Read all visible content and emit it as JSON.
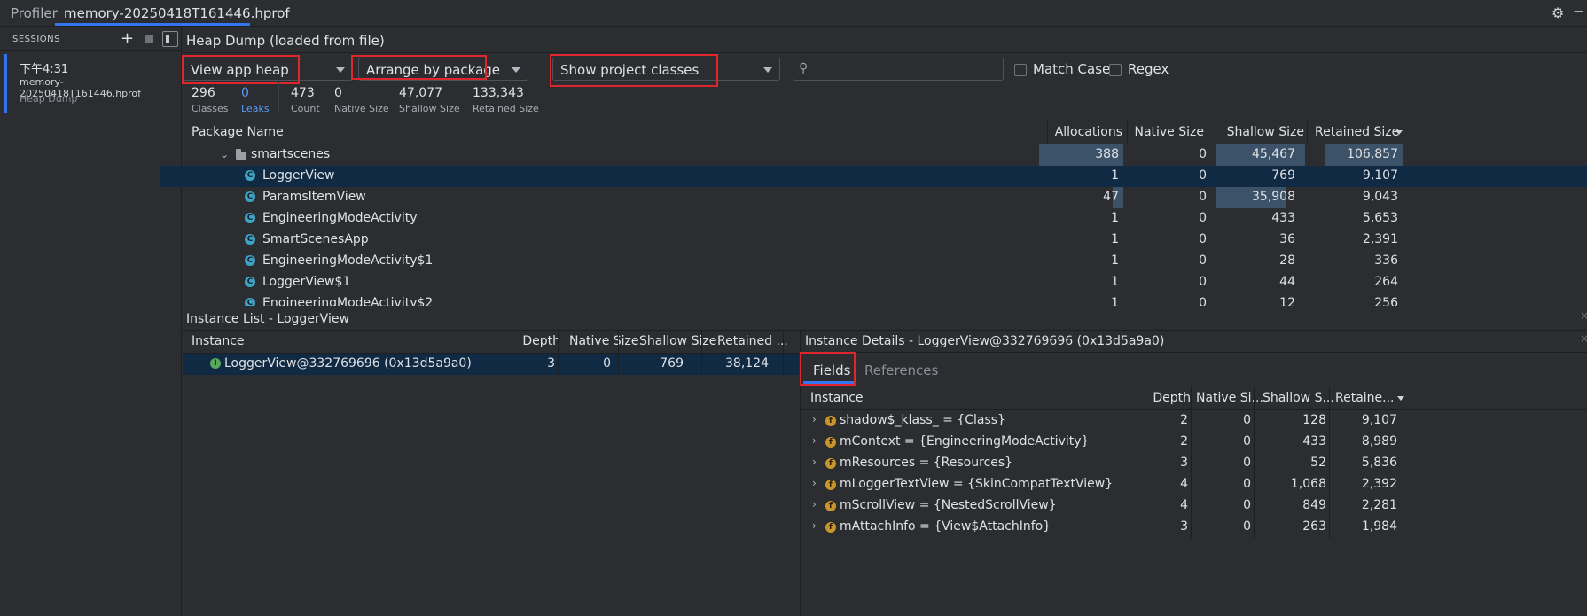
{
  "topbar": {
    "tool_title": "Profiler",
    "file_tab": "memory-20250418T161446.hprof",
    "settings_icon": "gear-icon",
    "minimize_icon": "minus-icon"
  },
  "sessions": {
    "header": "SESSIONS",
    "add_label": "+",
    "item": {
      "time": "下午4:31",
      "file": "memory-20250418T161446.hprof",
      "kind": "Heap Dump"
    }
  },
  "main": {
    "title": "Heap Dump (loaded from file)",
    "heap_select": "View app heap",
    "arrange_select": "Arrange by package",
    "filter_select": "Show project classes",
    "search_placeholder": "",
    "match_case": "Match Case",
    "regex": "Regex"
  },
  "stats": [
    {
      "value": "296",
      "label": "Classes"
    },
    {
      "value": "0",
      "label": "Leaks"
    },
    {
      "value": "473",
      "label": "Count"
    },
    {
      "value": "0",
      "label": "Native Size"
    },
    {
      "value": "47,077",
      "label": "Shallow Size"
    },
    {
      "value": "133,343",
      "label": "Retained Size"
    }
  ],
  "class_table": {
    "headers": {
      "name": "Package Name",
      "allocations": "Allocations",
      "native": "Native Size",
      "shallow": "Shallow Size",
      "retained": "Retained Size"
    },
    "package": {
      "name": "smartscenes",
      "allocations": "388",
      "native": "0",
      "shallow": "45,467",
      "retained": "106,857"
    },
    "rows": [
      {
        "name": "LoggerView",
        "allocations": "1",
        "native": "0",
        "shallow": "769",
        "retained": "9,107"
      },
      {
        "name": "ParamsItemView",
        "allocations": "47",
        "native": "0",
        "shallow": "35,908",
        "retained": "9,043"
      },
      {
        "name": "EngineeringModeActivity",
        "allocations": "1",
        "native": "0",
        "shallow": "433",
        "retained": "5,653"
      },
      {
        "name": "SmartScenesApp",
        "allocations": "1",
        "native": "0",
        "shallow": "36",
        "retained": "2,391"
      },
      {
        "name": "EngineeringModeActivity$1",
        "allocations": "1",
        "native": "0",
        "shallow": "28",
        "retained": "336"
      },
      {
        "name": "LoggerView$1",
        "allocations": "1",
        "native": "0",
        "shallow": "44",
        "retained": "264"
      },
      {
        "name": "EngineeringModeActivity$2",
        "allocations": "1",
        "native": "0",
        "shallow": "12",
        "retained": "256"
      }
    ]
  },
  "instance_list": {
    "title": "Instance List - LoggerView",
    "headers": {
      "instance": "Instance",
      "depth": "Depth",
      "native": "Native Size",
      "shallow": "Shallow Size",
      "retained": "Retained ..."
    },
    "row": {
      "instance": "LoggerView@332769696 (0x13d5a9a0)",
      "depth": "3",
      "native": "0",
      "shallow": "769",
      "retained": "38,124"
    }
  },
  "instance_details": {
    "title": "Instance Details - LoggerView@332769696 (0x13d5a9a0)",
    "tabs": [
      "Fields",
      "References"
    ],
    "headers": {
      "instance": "Instance",
      "depth": "Depth",
      "native": "Native Si...",
      "shallow": "Shallow S...",
      "retained": "Retaine..."
    },
    "rows": [
      {
        "instance": "shadow$_klass_ = {Class}",
        "depth": "2",
        "native": "0",
        "shallow": "128",
        "retained": "9,107"
      },
      {
        "instance": "mContext = {EngineeringModeActivity}",
        "depth": "2",
        "native": "0",
        "shallow": "433",
        "retained": "8,989"
      },
      {
        "instance": "mResources = {Resources}",
        "depth": "3",
        "native": "0",
        "shallow": "52",
        "retained": "5,836"
      },
      {
        "instance": "mLoggerTextView = {SkinCompatTextView}",
        "depth": "4",
        "native": "0",
        "shallow": "1,068",
        "retained": "2,392"
      },
      {
        "instance": "mScrollView = {NestedScrollView}",
        "depth": "4",
        "native": "0",
        "shallow": "849",
        "retained": "2,281"
      },
      {
        "instance": "mAttachInfo = {View$AttachInfo}",
        "depth": "3",
        "native": "0",
        "shallow": "263",
        "retained": "1,984"
      }
    ]
  },
  "icons": {
    "class": "C",
    "instance": "I",
    "field": "f"
  },
  "colors": {
    "accent": "#3574f0",
    "selection": "#0f2a42",
    "highlight_box": "#e0262d",
    "leaks_link": "#589df6"
  }
}
